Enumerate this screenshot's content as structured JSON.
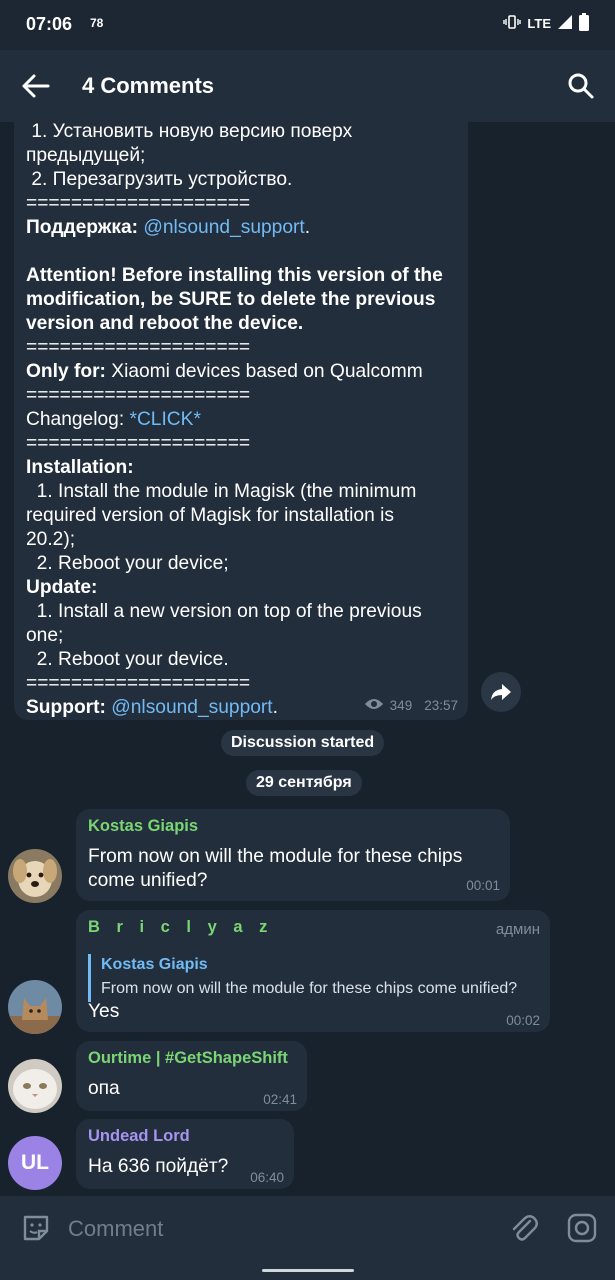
{
  "status_bar": {
    "time": "07:06",
    "notification_count": "78",
    "network": "LTE"
  },
  "header": {
    "title": "4 Comments"
  },
  "post": {
    "lines": [
      [
        {
          "t": " 1. Установить новую версию поверх"
        }
      ],
      [
        {
          "t": "предыдущей;"
        }
      ],
      [
        {
          "t": " 2. Перезагрузить устройство."
        }
      ],
      [
        {
          "t": "===================="
        }
      ],
      [
        {
          "t": "Поддержка:",
          "b": true
        },
        {
          "t": " "
        },
        {
          "t": "@nlsound_support",
          "link": true
        },
        {
          "t": "."
        }
      ],
      [
        {
          "t": ""
        }
      ],
      [
        {
          "t": "Attention! Before installing this version of the",
          "b": true
        }
      ],
      [
        {
          "t": "modification, be SURE to delete the previous",
          "b": true
        }
      ],
      [
        {
          "t": "version and reboot the device.",
          "b": true
        }
      ],
      [
        {
          "t": "===================="
        }
      ],
      [
        {
          "t": "Only for:",
          "b": true
        },
        {
          "t": " Xiaomi devices based on Qualcomm"
        }
      ],
      [
        {
          "t": "===================="
        }
      ],
      [
        {
          "t": "Changelog: "
        },
        {
          "t": "*CLICK*",
          "link": true
        }
      ],
      [
        {
          "t": "===================="
        }
      ],
      [
        {
          "t": "Installation:",
          "b": true
        }
      ],
      [
        {
          "t": "  1. Install the module in Magisk (the minimum"
        }
      ],
      [
        {
          "t": "required version of Magisk for installation is"
        }
      ],
      [
        {
          "t": "20.2);"
        }
      ],
      [
        {
          "t": "  2. Reboot your device;"
        }
      ],
      [
        {
          "t": "Update:",
          "b": true
        }
      ],
      [
        {
          "t": "  1. Install a new version on top of the previous"
        }
      ],
      [
        {
          "t": "one;"
        }
      ],
      [
        {
          "t": "  2. Reboot your device."
        }
      ],
      [
        {
          "t": "===================="
        }
      ],
      [
        {
          "t": "Support:",
          "b": true
        },
        {
          "t": " "
        },
        {
          "t": "@nlsound_support",
          "link": true
        },
        {
          "t": "."
        }
      ]
    ],
    "views": "349",
    "time": "23:57"
  },
  "service": {
    "discussion_started": "Discussion started",
    "date": "29 сентября"
  },
  "comments": [
    {
      "sender": "Kostas Giapis",
      "sender_color": "#7ad573",
      "text_lines": [
        "From now on will the module for these chips",
        "come unified?"
      ],
      "time": "00:01"
    },
    {
      "sender": "B r i c l y a z",
      "sender_color": "#7ad573",
      "role": "админ",
      "reply": {
        "name": "Kostas Giapis",
        "text": "From now on will the module for these chips come unified?"
      },
      "text_lines": [
        "Yes"
      ],
      "time": "00:02"
    },
    {
      "sender": "Ourtime | #GetShapeShift",
      "sender_color": "#7ad573",
      "text_lines": [
        "опа"
      ],
      "time": "02:41"
    },
    {
      "sender": "Undead Lord",
      "sender_color": "#a594f0",
      "avatar_initials": "UL",
      "text_lines": [
        "На 636 пойдёт?"
      ],
      "time": "06:40"
    }
  ],
  "input": {
    "placeholder": "Comment"
  },
  "colors": {
    "background": "#18222d",
    "bubble": "#232e3c",
    "link": "#71baf4",
    "avatar_ul": "#9b83e6"
  }
}
